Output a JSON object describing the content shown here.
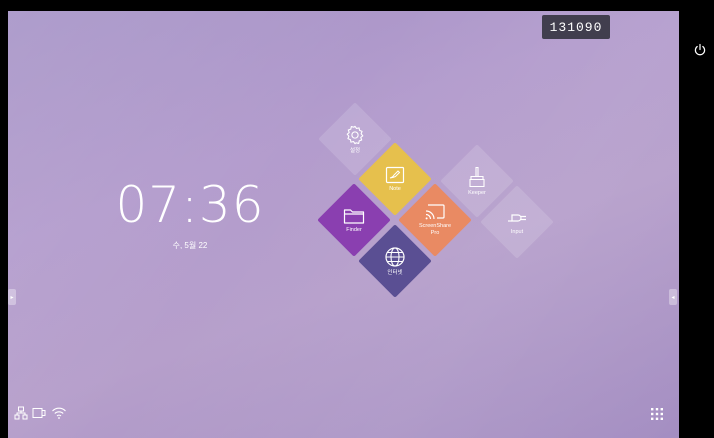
{
  "badge": {
    "id": "131090"
  },
  "clock": {
    "time": "07:36",
    "date": "수, 5월 22"
  },
  "tiles": [
    {
      "label": "설정",
      "icon": "gear-icon"
    },
    {
      "label": "Note",
      "icon": "note-icon",
      "color": "#e6c04d"
    },
    {
      "label": "Keeper",
      "icon": "brush-icon"
    },
    {
      "label": "Finder",
      "icon": "folder-icon",
      "color": "#8a3fb0"
    },
    {
      "label": "ScreenShare Pro",
      "icon": "cast-icon",
      "color": "#e98a63"
    },
    {
      "label": "Input",
      "icon": "plug-icon"
    },
    {
      "label": "인터넷",
      "icon": "globe-icon",
      "color": "#5a4f93"
    }
  ],
  "status_bar": {
    "icons": [
      "network-icon",
      "display-icon",
      "wifi-icon"
    ]
  },
  "system": {
    "power": "power-icon",
    "apps": "apps-grid-icon"
  }
}
